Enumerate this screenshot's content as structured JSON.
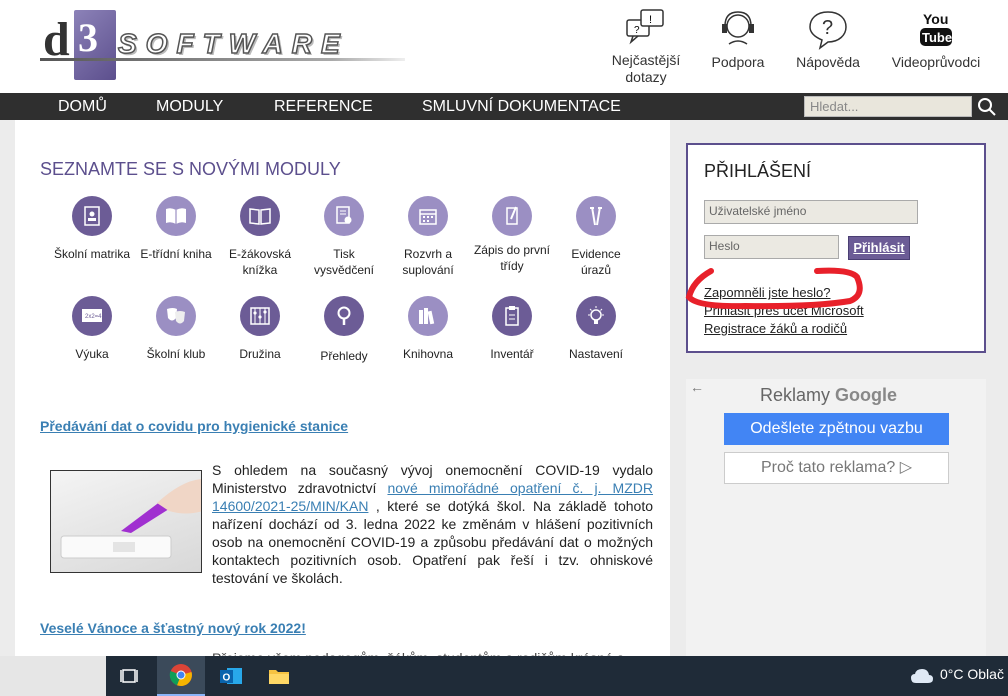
{
  "header": {
    "logo_text": "SOFTWARE",
    "logo_letter": "d",
    "logo_box_letter": "3",
    "links": [
      {
        "label": "Nejčastější dotazy",
        "icon": "faq-bubble-icon"
      },
      {
        "label": "Podpora",
        "icon": "headset-icon"
      },
      {
        "label": "Nápověda",
        "icon": "help-question-icon"
      },
      {
        "label": "Videoprůvodci",
        "icon": "youtube-icon"
      }
    ],
    "youtube_text": "You Tube"
  },
  "nav": {
    "items": [
      "DOMŮ",
      "MODULY",
      "REFERENCE",
      "SMLUVNÍ DOKUMENTACE"
    ],
    "search_placeholder": "Hledat..."
  },
  "modules": {
    "title": "SEZNAMTE SE S NOVÝMI MODULY",
    "items": [
      {
        "label": "Školní matrika",
        "icon": "id-card-icon"
      },
      {
        "label": "E-třídní kniha",
        "icon": "book-icon"
      },
      {
        "label": "E-žákovská knížka",
        "icon": "open-book-icon"
      },
      {
        "label": "Tisk vysvědčení",
        "icon": "certificate-icon"
      },
      {
        "label": "Rozvrh a suplování",
        "icon": "calendar-icon"
      },
      {
        "label": "Zápis do první třídy",
        "icon": "pen-icon"
      },
      {
        "label": "Evidence úrazů",
        "icon": "crutches-icon"
      },
      {
        "label": "Výuka",
        "icon": "blackboard-icon"
      },
      {
        "label": "Školní klub",
        "icon": "theater-masks-icon"
      },
      {
        "label": "Družina",
        "icon": "abacus-icon"
      },
      {
        "label": "Přehledy",
        "icon": "magnifier-icon"
      },
      {
        "label": "Knihovna",
        "icon": "books-icon"
      },
      {
        "label": "Inventář",
        "icon": "clipboard-icon"
      },
      {
        "label": "Nastavení",
        "icon": "lightbulb-icon"
      }
    ]
  },
  "articles": [
    {
      "title": "Předávání dat o covidu pro hygienické stanice",
      "text_before": "S ohledem na současný vývoj onemocnění COVID-19 vydalo Ministerstvo zdravotnictví ",
      "link": "nové mimořádné opatření č. j. MZDR 14600/2021-25/MIN/KAN",
      "text_after": " , které se dotýká škol. Na základě tohoto nařízení dochází od 3. ledna 2022 ke změnám v hlášení pozitivních osob na onemocnění COVID-19 a způsobu předávání dat o možných kontaktech pozitivních osob. Opatření pak řeší i tzv. ohniskové testování ve školách."
    },
    {
      "title": "Veselé Vánoce a šťastný nový rok 2022!",
      "text": "Přejeme všem pedagogům, žákům, studentům a rodičům krásné a"
    }
  ],
  "login": {
    "title": "PŘIHLÁŠENÍ",
    "username_placeholder": "Uživatelské jméno",
    "password_placeholder": "Heslo",
    "submit_label": "Přihlásit",
    "forgot_label": "Zapomněli jste heslo?",
    "microsoft_label": "Přihlásit přes účet Microsoft",
    "register_label": "Registrace žáků a rodičů",
    "annotation_color": "#e8202a"
  },
  "ad": {
    "back_arrow": "←",
    "title_prefix": "Reklamy",
    "title_brand": "Google",
    "feedback_label": "Odešlete zpětnou vazbu",
    "why_label": "Proč tato reklama? ▷"
  },
  "taskbar": {
    "weather": "0°C  Oblač"
  },
  "colors": {
    "accent": "#5c4f8d",
    "nav_bg": "#2f2f2f",
    "link": "#3a7fb3",
    "google_blue": "#4285f4"
  }
}
